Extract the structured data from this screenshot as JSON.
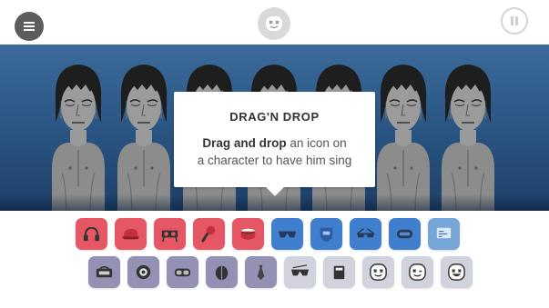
{
  "header": {
    "menu_icon": "hamburger-menu-icon",
    "logo_icon": "marshmello-logo-icon",
    "pause_icon": "pause-icon"
  },
  "tooltip": {
    "title": "DRAG'N DROP",
    "line1_bold": "Drag and drop",
    "line1_rest": " an icon on",
    "line2": "a character to have him sing"
  },
  "characters": {
    "count": 7
  },
  "palette": {
    "row1": [
      {
        "name": "headphones-icon",
        "color": "#e55765"
      },
      {
        "name": "cap-icon",
        "color": "#e55765"
      },
      {
        "name": "dj-decks-icon",
        "color": "#e55765"
      },
      {
        "name": "microphone-icon",
        "color": "#e55765"
      },
      {
        "name": "drum-icon",
        "color": "#e55765"
      },
      {
        "name": "sunglasses-icon",
        "color": "#3f7fcd"
      },
      {
        "name": "shield-badge-icon",
        "color": "#3f7fcd"
      },
      {
        "name": "3d-glasses-icon",
        "color": "#3f7fcd"
      },
      {
        "name": "visor-icon",
        "color": "#3f7fcd"
      },
      {
        "name": "screen-icon",
        "color": "#74a6d8"
      }
    ],
    "row2": [
      {
        "name": "boombox-icon",
        "color": "#9492b4"
      },
      {
        "name": "speaker-icon",
        "color": "#9492b4"
      },
      {
        "name": "goggles-icon",
        "color": "#9492b4"
      },
      {
        "name": "beetle-icon",
        "color": "#9492b4"
      },
      {
        "name": "tie-icon",
        "color": "#9492b4"
      },
      {
        "name": "wave-glasses-icon",
        "color": "#d0d2dc"
      },
      {
        "name": "mug-icon",
        "color": "#d0d2dc"
      },
      {
        "name": "marshmello-face-icon",
        "color": "#d0d2dc"
      },
      {
        "name": "marshmello-wink-icon",
        "color": "#d0d2dc"
      },
      {
        "name": "marshmello-smile-icon",
        "color": "#d0d2dc"
      }
    ]
  }
}
